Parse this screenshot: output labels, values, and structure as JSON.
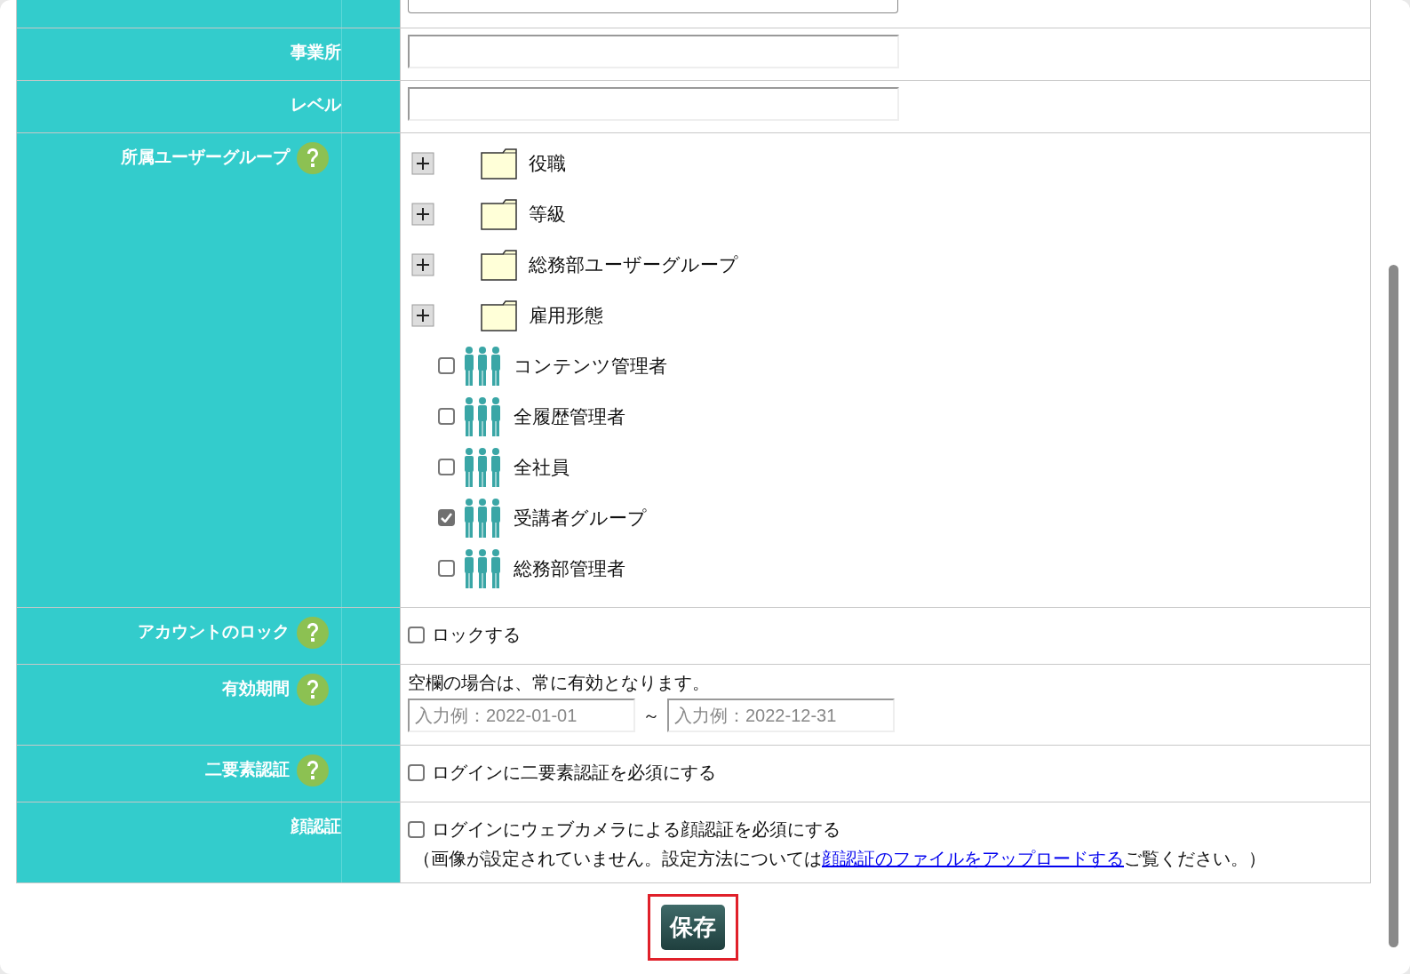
{
  "form": {
    "rows": [
      {
        "kind": "textarea"
      },
      {
        "kind": "text",
        "label": "事業所",
        "help": false,
        "value": ""
      },
      {
        "kind": "text",
        "label": "レベル",
        "help": false,
        "value": ""
      },
      {
        "kind": "groups",
        "label": "所属ユーザーグループ",
        "help": true,
        "folders": [
          {
            "name": "役職",
            "expanded": false
          },
          {
            "name": "等級",
            "expanded": false
          },
          {
            "name": "総務部ユーザーグループ",
            "expanded": false
          },
          {
            "name": "雇用形態",
            "expanded": false
          }
        ],
        "groups": [
          {
            "name": "コンテンツ管理者",
            "checked": false
          },
          {
            "name": "全履歴管理者",
            "checked": false
          },
          {
            "name": "全社員",
            "checked": false
          },
          {
            "name": "受講者グループ",
            "checked": true
          },
          {
            "name": "総務部管理者",
            "checked": false
          }
        ]
      },
      {
        "kind": "check",
        "label": "アカウントのロック",
        "help": true,
        "option": "ロックする",
        "checked": false
      },
      {
        "kind": "period",
        "label": "有効期間",
        "help": true,
        "note": "空欄の場合は、常に有効となります。",
        "from_placeholder": "入力例：2022-01-01",
        "separator": "～",
        "to_placeholder": "入力例：2022-12-31"
      },
      {
        "kind": "check",
        "label": "二要素認証",
        "help": true,
        "option": "ログインに二要素認証を必須にする",
        "checked": false
      },
      {
        "kind": "face",
        "label": "顔認証",
        "help": false,
        "option": "ログインにウェブカメラによる顔認証を必須にする",
        "checked": false,
        "note_before": "（画像が設定されていません。設定方法については",
        "link": "顔認証のファイルをアップロードする",
        "note_after": "ご覧ください。）"
      }
    ]
  },
  "save_button": {
    "label": "保存",
    "highlighted": true
  }
}
